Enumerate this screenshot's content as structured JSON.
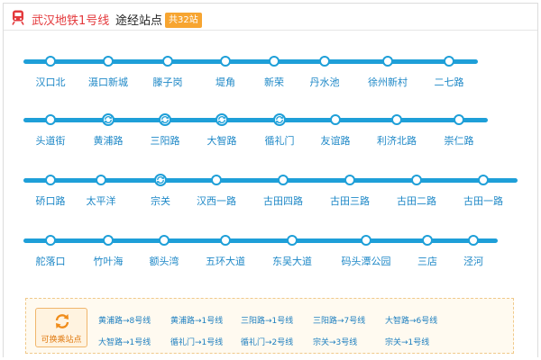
{
  "header": {
    "title": "武汉地铁1号线",
    "subtitle": "途经站点",
    "count_badge": "共32站"
  },
  "line_color": "#1e9fd8",
  "transfer_icon_color": "#1e9fd8",
  "badge_color": "#f7a531",
  "rows": [
    {
      "stations": [
        {
          "name": "汉口北",
          "transfer": false
        },
        {
          "name": "滠口新城",
          "transfer": false
        },
        {
          "name": "滕子岗",
          "transfer": false
        },
        {
          "name": "堤角",
          "transfer": false
        },
        {
          "name": "新荣",
          "transfer": false
        },
        {
          "name": "丹水池",
          "transfer": false
        },
        {
          "name": "徐州新村",
          "transfer": false
        },
        {
          "name": "二七路",
          "transfer": false
        }
      ]
    },
    {
      "stations": [
        {
          "name": "头道街",
          "transfer": false
        },
        {
          "name": "黄浦路",
          "transfer": true
        },
        {
          "name": "三阳路",
          "transfer": true
        },
        {
          "name": "大智路",
          "transfer": true
        },
        {
          "name": "循礼门",
          "transfer": true
        },
        {
          "name": "友谊路",
          "transfer": false
        },
        {
          "name": "利济北路",
          "transfer": false
        },
        {
          "name": "崇仁路",
          "transfer": false
        }
      ]
    },
    {
      "stations": [
        {
          "name": "硚口路",
          "transfer": false
        },
        {
          "name": "太平洋",
          "transfer": false
        },
        {
          "name": "宗关",
          "transfer": true
        },
        {
          "name": "汉西一路",
          "transfer": false
        },
        {
          "name": "古田四路",
          "transfer": false
        },
        {
          "name": "古田三路",
          "transfer": false
        },
        {
          "name": "古田二路",
          "transfer": false
        },
        {
          "name": "古田一路",
          "transfer": false
        }
      ]
    },
    {
      "stations": [
        {
          "name": "舵落口",
          "transfer": false
        },
        {
          "name": "竹叶海",
          "transfer": false
        },
        {
          "name": "额头湾",
          "transfer": false
        },
        {
          "name": "五环大道",
          "transfer": false
        },
        {
          "name": "东吴大道",
          "transfer": false
        },
        {
          "name": "码头潭公园",
          "transfer": false
        },
        {
          "name": "三店",
          "transfer": false
        },
        {
          "name": "泾河",
          "transfer": false
        }
      ]
    }
  ],
  "transfer_section": {
    "label": "可换乘站点",
    "items": [
      "黄浦路→8号线",
      "黄浦路→1号线",
      "三阳路→1号线",
      "三阳路→7号线",
      "大智路→6号线",
      "大智路→1号线",
      "循礼门→1号线",
      "循礼门→2号线",
      "宗关→3号线",
      "宗关→1号线"
    ]
  }
}
